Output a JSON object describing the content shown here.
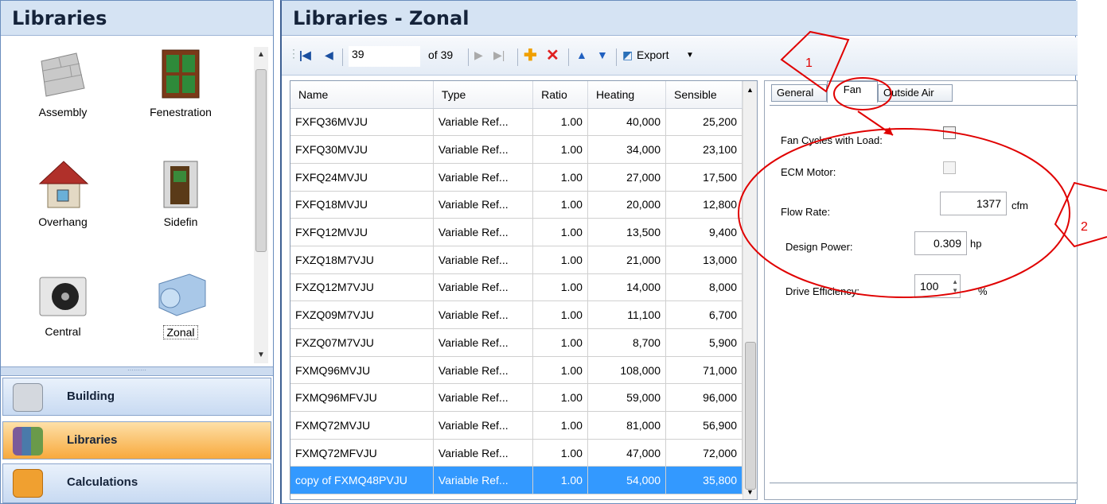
{
  "left_panel": {
    "title": "Libraries",
    "items": [
      {
        "label": "Assembly",
        "icon": "brick-wall-icon"
      },
      {
        "label": "Fenestration",
        "icon": "window-icon"
      },
      {
        "label": "Overhang",
        "icon": "house-roof-icon"
      },
      {
        "label": "Sidefin",
        "icon": "door-fin-icon"
      },
      {
        "label": "Central",
        "icon": "condenser-unit-icon"
      },
      {
        "label": "Zonal",
        "icon": "duct-fan-icon"
      }
    ],
    "nav": [
      {
        "label": "Building",
        "icon": "building-icon"
      },
      {
        "label": "Libraries",
        "icon": "books-icon"
      },
      {
        "label": "Calculations",
        "icon": "calculator-icon"
      }
    ]
  },
  "main": {
    "title": "Libraries - Zonal",
    "toolbar": {
      "record": "39",
      "of_total": "of 39",
      "export_label": "Export"
    },
    "table": {
      "columns": [
        "Name",
        "Type",
        "Ratio",
        "Heating",
        "Sensible"
      ],
      "rows": [
        [
          "FXFQ36MVJU",
          "Variable Ref...",
          "1.00",
          "40,000",
          "25,200"
        ],
        [
          "FXFQ30MVJU",
          "Variable Ref...",
          "1.00",
          "34,000",
          "23,100"
        ],
        [
          "FXFQ24MVJU",
          "Variable Ref...",
          "1.00",
          "27,000",
          "17,500"
        ],
        [
          "FXFQ18MVJU",
          "Variable Ref...",
          "1.00",
          "20,000",
          "12,800"
        ],
        [
          "FXFQ12MVJU",
          "Variable Ref...",
          "1.00",
          "13,500",
          "9,400"
        ],
        [
          "FXZQ18M7VJU",
          "Variable Ref...",
          "1.00",
          "21,000",
          "13,000"
        ],
        [
          "FXZQ12M7VJU",
          "Variable Ref...",
          "1.00",
          "14,000",
          "8,000"
        ],
        [
          "FXZQ09M7VJU",
          "Variable Ref...",
          "1.00",
          "11,100",
          "6,700"
        ],
        [
          "FXZQ07M7VJU",
          "Variable Ref...",
          "1.00",
          "8,700",
          "5,900"
        ],
        [
          "FXMQ96MVJU",
          "Variable Ref...",
          "1.00",
          "108,000",
          "71,000"
        ],
        [
          "FXMQ96MFVJU",
          "Variable Ref...",
          "1.00",
          "59,000",
          "96,000"
        ],
        [
          "FXMQ72MVJU",
          "Variable Ref...",
          "1.00",
          "81,000",
          "56,900"
        ],
        [
          "FXMQ72MFVJU",
          "Variable Ref...",
          "1.00",
          "47,000",
          "72,000"
        ],
        [
          "copy of FXMQ48PVJU",
          "Variable Ref...",
          "1.00",
          "54,000",
          "35,800"
        ]
      ],
      "selected_index": 13
    },
    "properties": {
      "tabs": [
        "General",
        "Fan",
        "Outside Air"
      ],
      "active_tab": "Fan",
      "fan_cycles_label": "Fan Cycles with Load:",
      "ecm_label": "ECM Motor:",
      "flow_rate_label": "Flow Rate:",
      "flow_rate_value": "1377",
      "flow_rate_unit": "cfm",
      "design_power_label": "Design Power:",
      "design_power_value": "0.309",
      "design_power_unit": "hp",
      "drive_eff_label": "Drive Efficiency:",
      "drive_eff_value": "100",
      "drive_eff_unit": "%"
    }
  },
  "annotations": {
    "callout1": "1",
    "callout2": "2",
    "color": "#e00000"
  }
}
